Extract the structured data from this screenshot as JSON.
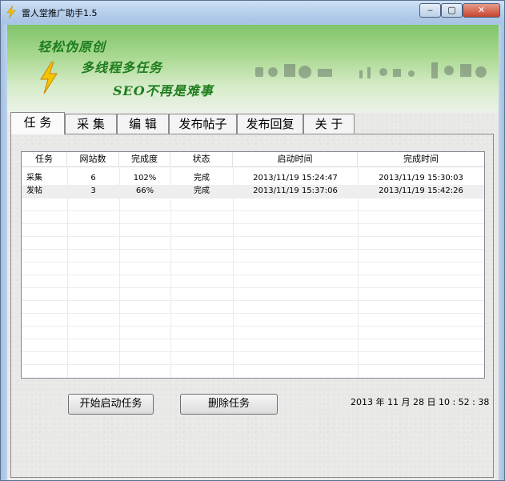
{
  "window": {
    "title": "雷人堂推广助手1.5",
    "controls": {
      "minimize": "‒",
      "maximize": "▢",
      "close": "✕"
    }
  },
  "banner": {
    "line1": "轻松伪原创",
    "line2": "多线程多任务",
    "line3": "SEO不再是难事"
  },
  "tabs": [
    {
      "label": "任 务",
      "active": true
    },
    {
      "label": "采 集"
    },
    {
      "label": "编 辑"
    },
    {
      "label": "发布帖子"
    },
    {
      "label": "发布回复"
    },
    {
      "label": "关 于"
    }
  ],
  "table": {
    "columns": [
      "任务",
      "网站数",
      "完成度",
      "状态",
      "启动时间",
      "完成时间"
    ],
    "rows": [
      [
        "采集",
        "6",
        "102%",
        "完成",
        "2013/11/19 15:24:47",
        "2013/11/19 15:30:03"
      ],
      [
        "发帖",
        "3",
        "66%",
        "完成",
        "2013/11/19 15:37:06",
        "2013/11/19 15:42:26"
      ]
    ]
  },
  "buttons": {
    "start": "开始启动任务",
    "delete": "删除任务"
  },
  "datetime": "2013 年 11 月 28 日 10 : 52 : 38",
  "colors": {
    "slogan": "#1e7d1e",
    "bolt": "#f2c300"
  }
}
